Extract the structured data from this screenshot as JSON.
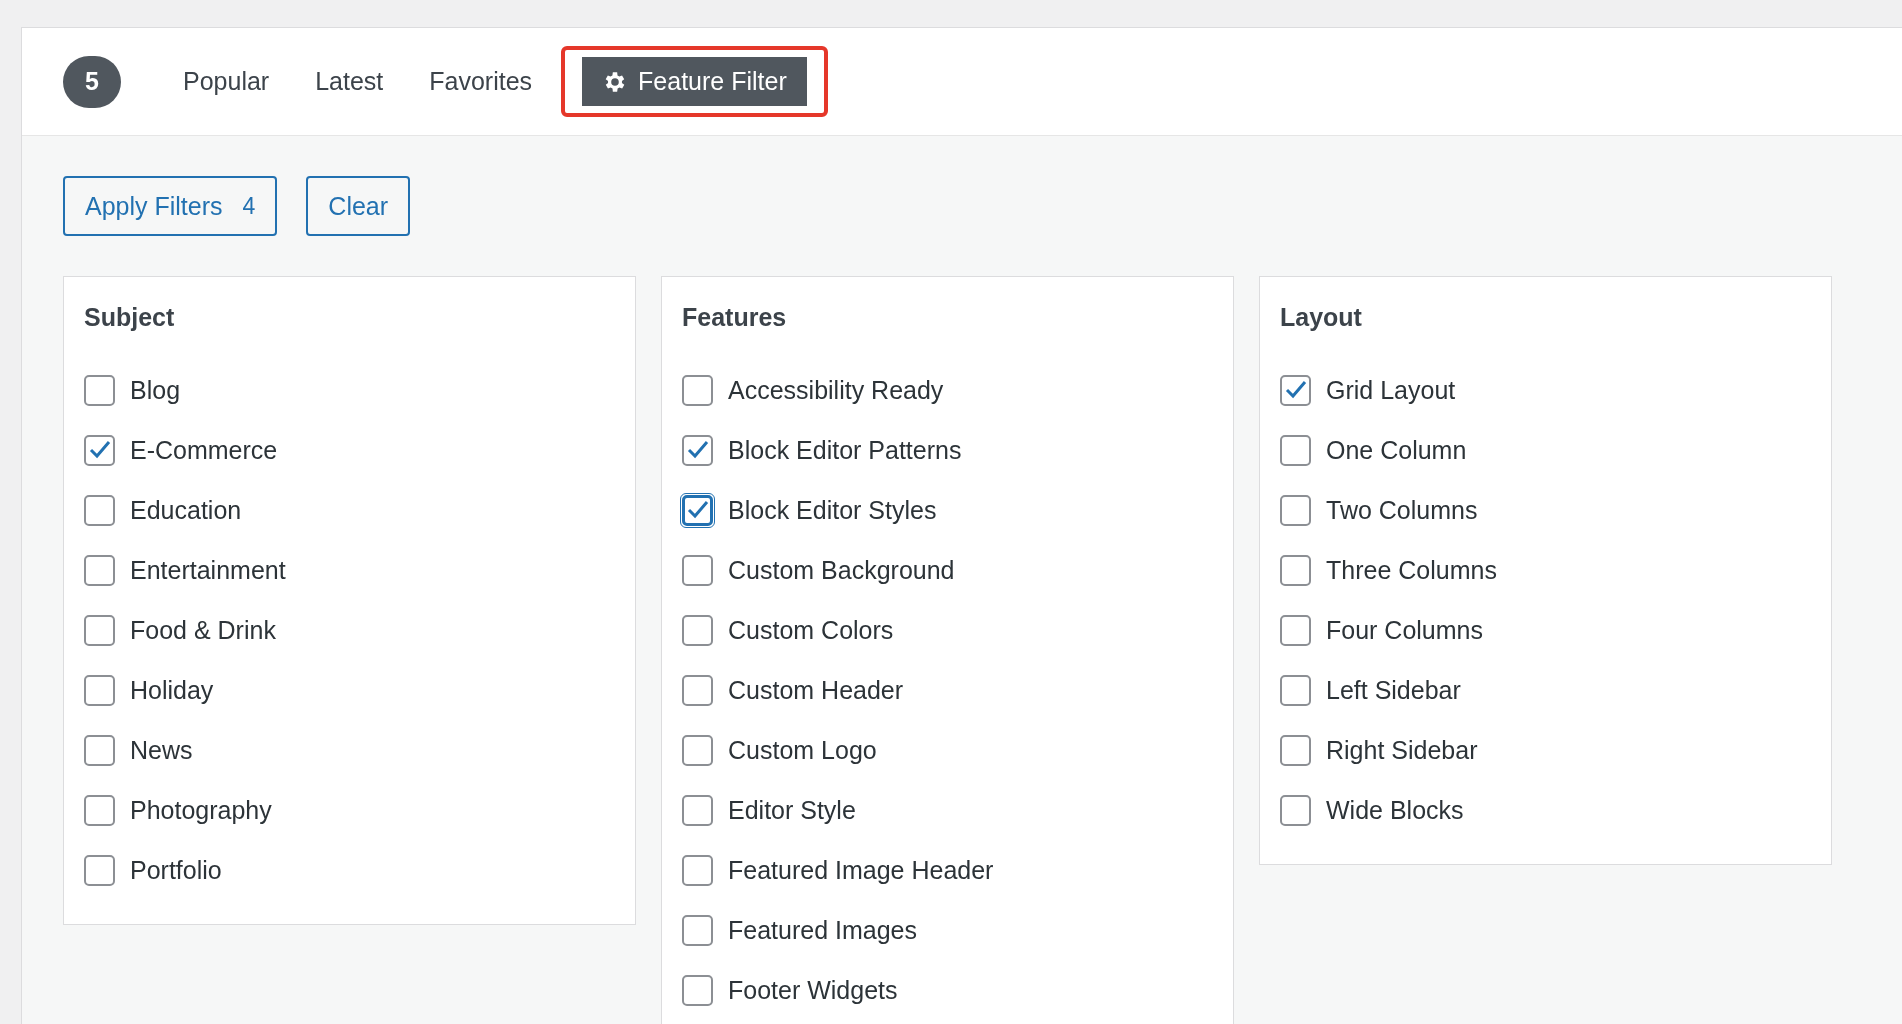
{
  "count_badge": "5",
  "tabs": [
    {
      "label": "Popular",
      "selected": false
    },
    {
      "label": "Latest",
      "selected": false
    },
    {
      "label": "Favorites",
      "selected": false
    },
    {
      "label": "Feature Filter",
      "selected": true,
      "highlighted": true
    }
  ],
  "actions": {
    "apply": {
      "label": "Apply Filters",
      "count": "4"
    },
    "clear": {
      "label": "Clear"
    }
  },
  "groups": [
    {
      "title": "Subject",
      "items": [
        {
          "label": "Blog",
          "checked": false,
          "focused": false
        },
        {
          "label": "E-Commerce",
          "checked": true,
          "focused": false
        },
        {
          "label": "Education",
          "checked": false,
          "focused": false
        },
        {
          "label": "Entertainment",
          "checked": false,
          "focused": false
        },
        {
          "label": "Food & Drink",
          "checked": false,
          "focused": false
        },
        {
          "label": "Holiday",
          "checked": false,
          "focused": false
        },
        {
          "label": "News",
          "checked": false,
          "focused": false
        },
        {
          "label": "Photography",
          "checked": false,
          "focused": false
        },
        {
          "label": "Portfolio",
          "checked": false,
          "focused": false
        }
      ]
    },
    {
      "title": "Features",
      "items": [
        {
          "label": "Accessibility Ready",
          "checked": false,
          "focused": false
        },
        {
          "label": "Block Editor Patterns",
          "checked": true,
          "focused": false
        },
        {
          "label": "Block Editor Styles",
          "checked": true,
          "focused": true
        },
        {
          "label": "Custom Background",
          "checked": false,
          "focused": false
        },
        {
          "label": "Custom Colors",
          "checked": false,
          "focused": false
        },
        {
          "label": "Custom Header",
          "checked": false,
          "focused": false
        },
        {
          "label": "Custom Logo",
          "checked": false,
          "focused": false
        },
        {
          "label": "Editor Style",
          "checked": false,
          "focused": false
        },
        {
          "label": "Featured Image Header",
          "checked": false,
          "focused": false
        },
        {
          "label": "Featured Images",
          "checked": false,
          "focused": false
        },
        {
          "label": "Footer Widgets",
          "checked": false,
          "focused": false
        }
      ]
    },
    {
      "title": "Layout",
      "items": [
        {
          "label": "Grid Layout",
          "checked": true,
          "focused": false
        },
        {
          "label": "One Column",
          "checked": false,
          "focused": false
        },
        {
          "label": "Two Columns",
          "checked": false,
          "focused": false
        },
        {
          "label": "Three Columns",
          "checked": false,
          "focused": false
        },
        {
          "label": "Four Columns",
          "checked": false,
          "focused": false
        },
        {
          "label": "Left Sidebar",
          "checked": false,
          "focused": false
        },
        {
          "label": "Right Sidebar",
          "checked": false,
          "focused": false
        },
        {
          "label": "Wide Blocks",
          "checked": false,
          "focused": false
        }
      ]
    }
  ]
}
